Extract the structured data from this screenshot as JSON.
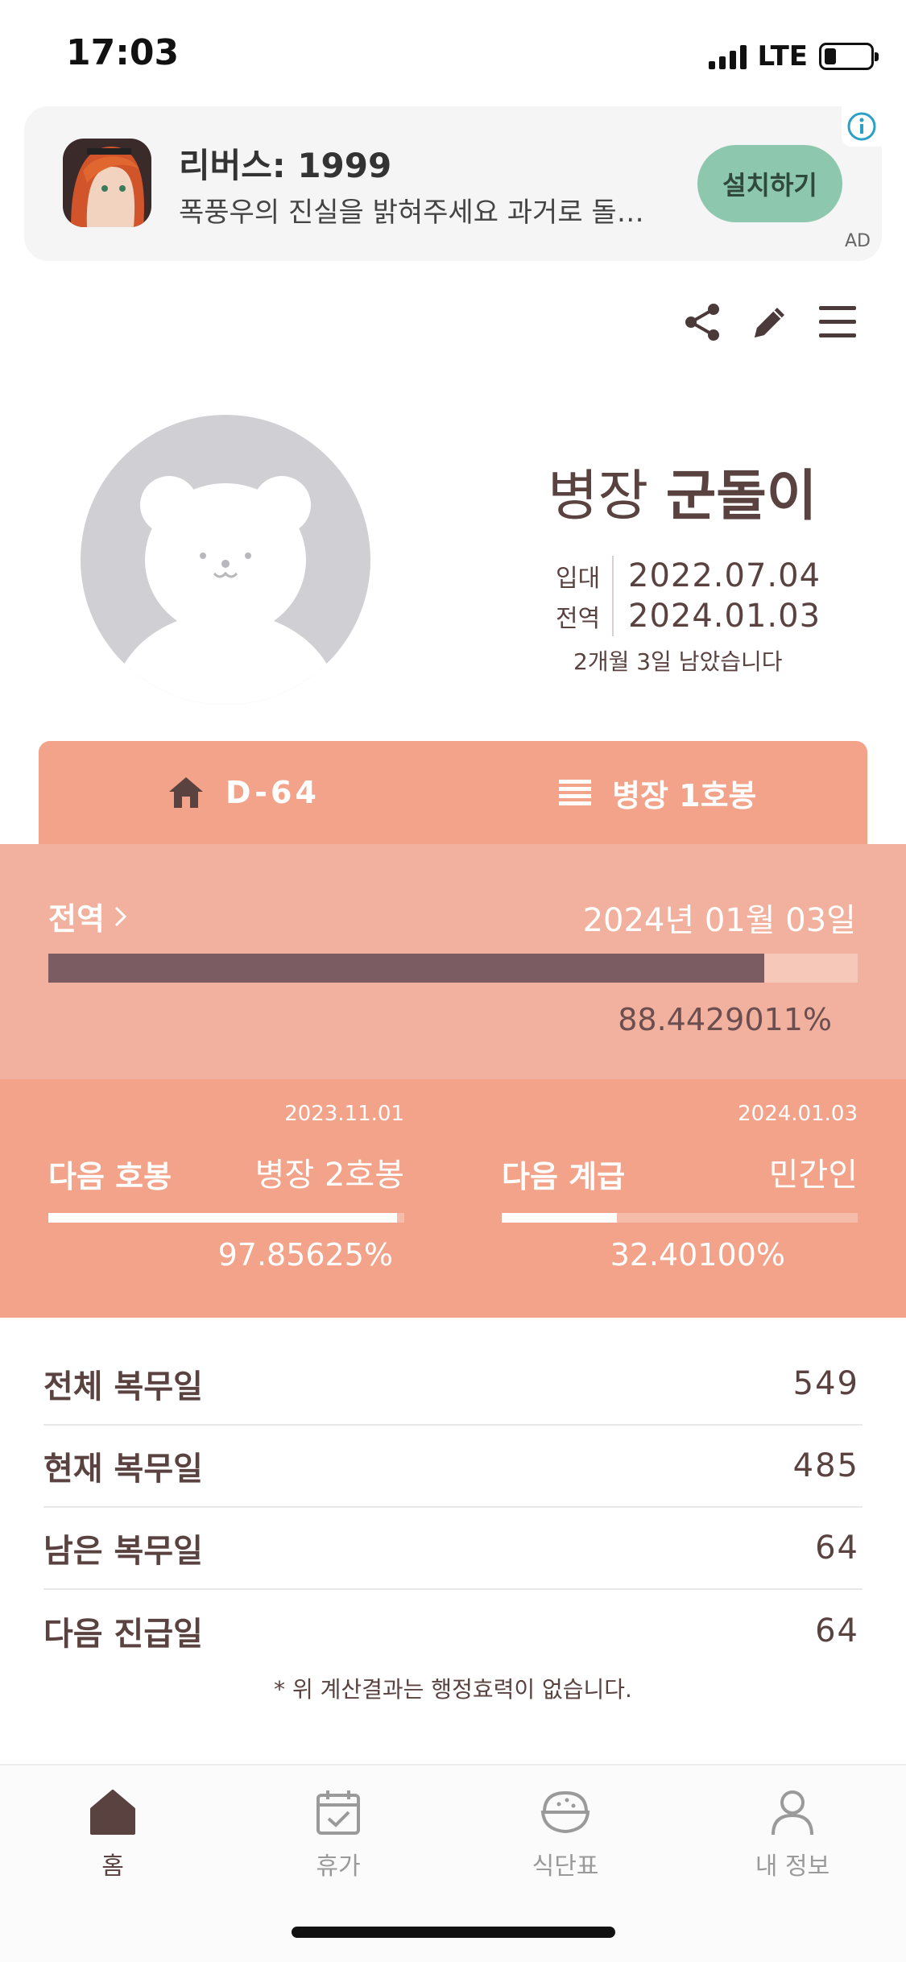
{
  "status_bar": {
    "time": "17:03",
    "network": "LTE"
  },
  "ad": {
    "title": "리버스: 1999",
    "description": "폭풍우의 진실을 밝혀주세요 과거로 돌…",
    "install_label": "설치하기",
    "ad_label": "AD"
  },
  "profile": {
    "rank": "병장",
    "name": "군돌이",
    "enlist_label": "입대",
    "enlist_date": "2022.07.04",
    "discharge_label": "전역",
    "discharge_date": "2024.01.03",
    "remaining_text": "2개월 3일 남았습니다"
  },
  "tabs": {
    "dday": "D-64",
    "grade": "병장 1호봉"
  },
  "discharge": {
    "label": "전역",
    "date": "2024년 01월 03일",
    "percent_text": "88.4429011%",
    "progress": 0.884429011
  },
  "next_step": {
    "title": "다음 호봉",
    "date": "2023.11.01",
    "value": "병장 2호봉",
    "percent_text": "97.85625%",
    "progress": 0.9785625
  },
  "next_rank": {
    "title": "다음 계급",
    "date": "2024.01.03",
    "value": "민간인",
    "percent_text": "32.40100%",
    "progress": 0.32401
  },
  "stats": [
    {
      "label": "전체 복무일",
      "value": "549"
    },
    {
      "label": "현재 복무일",
      "value": "485"
    },
    {
      "label": "남은 복무일",
      "value": "64"
    },
    {
      "label": "다음 진급일",
      "value": "64"
    }
  ],
  "disclaimer": "* 위 계산결과는 행정효력이 없습니다.",
  "nav": [
    {
      "label": "홈",
      "icon": "home-icon",
      "active": true
    },
    {
      "label": "휴가",
      "icon": "calendar-check-icon",
      "active": false
    },
    {
      "label": "식단표",
      "icon": "rice-bowl-icon",
      "active": false
    },
    {
      "label": "내 정보",
      "icon": "person-icon",
      "active": false
    }
  ],
  "colors": {
    "accent": "#f2a38a",
    "discharge_bg": "#f2b19e",
    "progress_fill": "#7a5c62",
    "text": "#5a4240",
    "install_button": "#8dc7ad"
  }
}
